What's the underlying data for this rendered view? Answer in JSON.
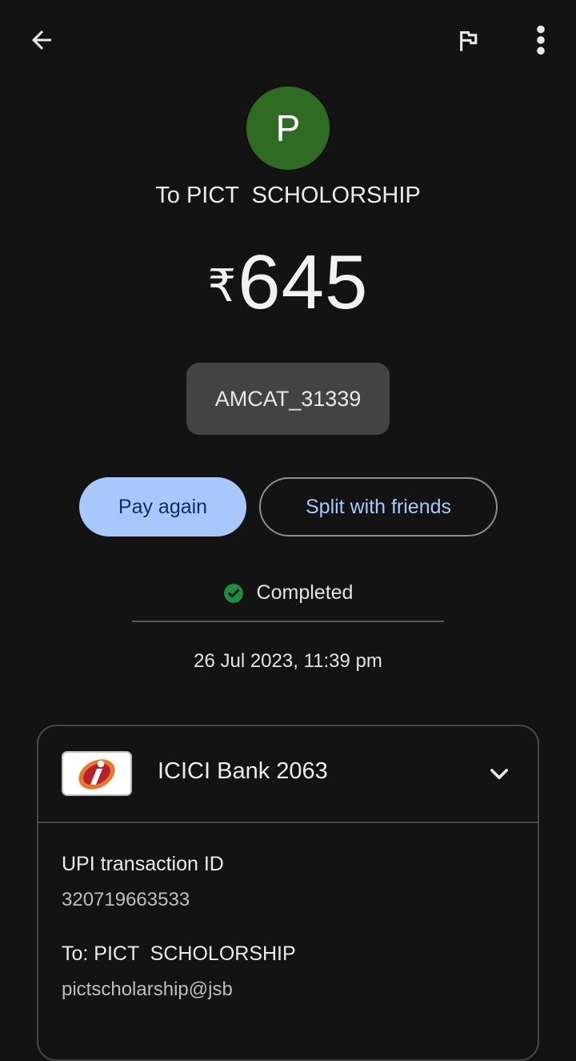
{
  "header": {
    "back_icon": "arrow-back-icon",
    "report_icon": "flag-icon",
    "more_icon": "more-vert-icon"
  },
  "payee": {
    "avatar_letter": "P",
    "avatar_color": "#2f6b22",
    "title": "To PICT  SCHOLORSHIP"
  },
  "amount": {
    "currency": "₹",
    "value": "645"
  },
  "note": "AMCAT_31339",
  "actions": {
    "pay_again": "Pay again",
    "split": "Split with friends",
    "accent": "#a8c7fa"
  },
  "status": {
    "label": "Completed",
    "color": "#1e8e3e",
    "datetime": "26 Jul 2023, 11:39 pm"
  },
  "details": {
    "bank_name": "ICICI Bank 2063",
    "bank_logo_icon": "icici-bank-logo",
    "upi_label": "UPI transaction ID",
    "upi_id": "320719663533",
    "to_label": "To: PICT  SCHOLORSHIP",
    "to_vpa": "pictscholarship@jsb"
  }
}
